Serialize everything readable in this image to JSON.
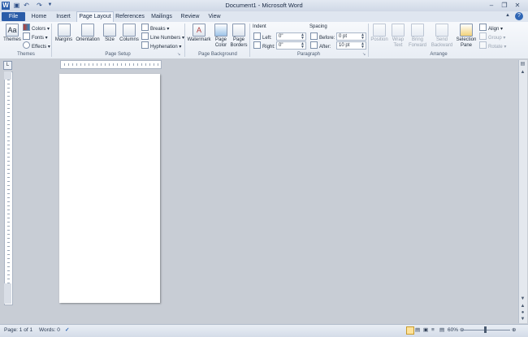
{
  "window": {
    "title": "Document1  -  Microsoft Word",
    "app_icon": "W"
  },
  "quick_access": [
    "save-icon",
    "undo-icon",
    "redo-icon",
    "customize-icon"
  ],
  "tabs": [
    {
      "label": "File",
      "active": false
    },
    {
      "label": "Home",
      "active": false
    },
    {
      "label": "Insert",
      "active": false
    },
    {
      "label": "Page Layout",
      "active": true
    },
    {
      "label": "References",
      "active": false
    },
    {
      "label": "Mailings",
      "active": false
    },
    {
      "label": "Review",
      "active": false
    },
    {
      "label": "View",
      "active": false
    }
  ],
  "ribbon": {
    "themes": {
      "themes_label": "Themes",
      "colors": "Colors",
      "fonts": "Fonts",
      "effects": "Effects",
      "group_label": "Themes"
    },
    "page_setup": {
      "margins": "Margins",
      "orientation": "Orientation",
      "size": "Size",
      "columns": "Columns",
      "breaks": "Breaks",
      "line_numbers": "Line Numbers",
      "hyphenation": "Hyphenation",
      "group_label": "Page Setup"
    },
    "page_background": {
      "watermark": "Watermark",
      "page_color_1": "Page",
      "page_color_2": "Color",
      "page_borders_1": "Page",
      "page_borders_2": "Borders",
      "group_label": "Page Background"
    },
    "paragraph": {
      "indent_label": "Indent",
      "left_label": "Left:",
      "left_value": "0\"",
      "right_label": "Right:",
      "right_value": "0\"",
      "spacing_label": "Spacing",
      "before_label": "Before:",
      "before_value": "0 pt",
      "after_label": "After:",
      "after_value": "10 pt",
      "group_label": "Paragraph"
    },
    "arrange": {
      "position": "Position",
      "wrap_1": "Wrap",
      "wrap_2": "Text",
      "bring_1": "Bring",
      "bring_2": "Forward",
      "send_1": "Send",
      "send_2": "Backward",
      "selection_1": "Selection",
      "selection_2": "Pane",
      "align": "Align",
      "group": "Group",
      "rotate": "Rotate",
      "group_label": "Arrange"
    }
  },
  "status": {
    "page": "Page: 1 of 1",
    "words": "Words: 0",
    "zoom": "60%"
  }
}
